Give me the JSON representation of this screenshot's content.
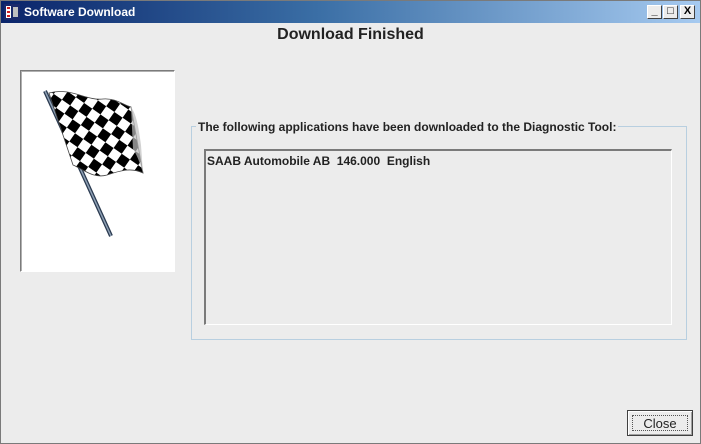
{
  "window": {
    "title": "Software Download",
    "controls": {
      "minimize": "_",
      "maximize": "□",
      "close": "X"
    }
  },
  "heading": "Download Finished",
  "flag": {
    "icon": "checkered-flag-icon"
  },
  "group": {
    "label": "The following applications have been downloaded to the Diagnostic Tool:",
    "items": [
      "SAAB Automobile AB  146.000  English"
    ]
  },
  "buttons": {
    "close": "Close"
  }
}
